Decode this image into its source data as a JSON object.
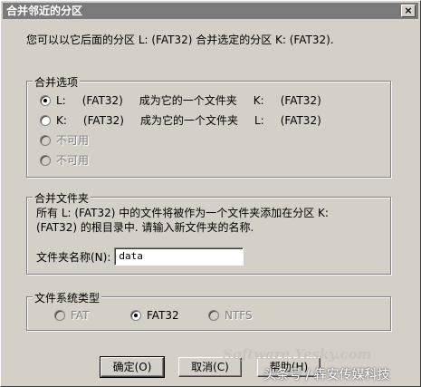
{
  "title": "合并邻近的分区",
  "close": "×",
  "intro": "您可以以它后面的分区 L:  (FAT32) 合并选定的分区 K:  (FAT32).",
  "merge": {
    "title": "合并选项",
    "options": [
      {
        "prefix": "L:",
        "fs": "(FAT32)",
        "action": "成为它的一个文件夹",
        "target": "K:",
        "target_fs": "(FAT32)",
        "checked": true
      },
      {
        "prefix": "K:",
        "fs": "(FAT32)",
        "action": "成为它的一个文件夹",
        "target": "L:",
        "target_fs": "(FAT32)",
        "checked": false
      }
    ],
    "unavailable": [
      "不可用",
      "不可用"
    ]
  },
  "folder": {
    "title": "合并文件夹",
    "desc1": "所有 L:  (FAT32) 中的文件将被作为一个文件夹添加在分区 K:",
    "desc2": "(FAT32) 的根目录中. 请输入新文件夹的名称.",
    "name_label": "文件夹名称(N):",
    "name_value": "data"
  },
  "fs": {
    "title": "文件系统类型",
    "options": [
      {
        "label": "FAT",
        "checked": false,
        "disabled": true
      },
      {
        "label": "FAT32",
        "checked": true,
        "disabled": false
      },
      {
        "label": "NTFS",
        "checked": false,
        "disabled": true
      }
    ]
  },
  "buttons": {
    "ok": "确定(O)",
    "cancel": "取消(C)",
    "help": "帮助(H)"
  },
  "watermark": {
    "site": "Software.Yesky.com",
    "credit": "头条号 / 犇安传媒科技"
  }
}
